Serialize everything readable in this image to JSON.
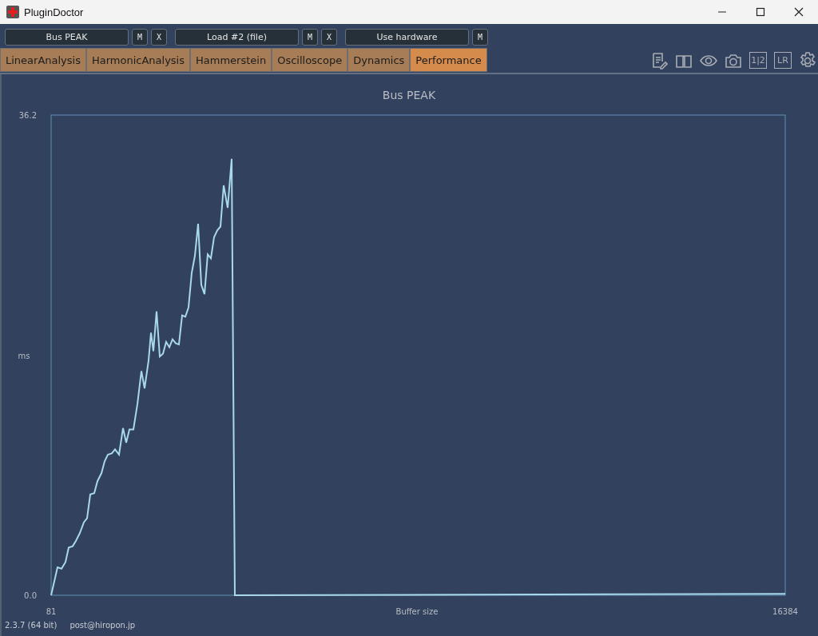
{
  "window": {
    "title": "PluginDoctor"
  },
  "slots": [
    {
      "label": "Bus PEAK",
      "buttons": [
        "M",
        "X"
      ]
    },
    {
      "label": "Load #2 (file)",
      "buttons": [
        "M",
        "X"
      ]
    },
    {
      "label": "Use hardware",
      "buttons": [
        "M"
      ]
    }
  ],
  "tabs": [
    {
      "label": "LinearAnalysis",
      "selected": false
    },
    {
      "label": "HarmonicAnalysis",
      "selected": false
    },
    {
      "label": "Hammerstein",
      "selected": false
    },
    {
      "label": "Oscilloscope",
      "selected": false
    },
    {
      "label": "Dynamics",
      "selected": false
    },
    {
      "label": "Performance",
      "selected": true
    }
  ],
  "tools": [
    {
      "kind": "notes"
    },
    {
      "kind": "book"
    },
    {
      "kind": "eye"
    },
    {
      "kind": "camera"
    },
    {
      "kind": "text",
      "label": "1|2"
    },
    {
      "kind": "text",
      "label": "LR"
    },
    {
      "kind": "gear"
    }
  ],
  "chart": {
    "chart_data": {
      "type": "line",
      "title": "Bus PEAK",
      "xlabel": "Buffer size",
      "ylabel": "ms",
      "xlim": [
        81,
        16384
      ],
      "ylim": [
        0,
        36.2
      ],
      "xticks": [
        81,
        16384
      ],
      "yticks": [
        {
          "value": 0,
          "label": "0.0"
        },
        36.2
      ],
      "x": [
        81,
        223,
        312,
        401,
        472,
        560,
        631,
        720,
        808,
        879,
        950,
        1039,
        1110,
        1199,
        1270,
        1341,
        1429,
        1500,
        1589,
        1678,
        1749,
        1820,
        1908,
        1997,
        2086,
        2157,
        2245,
        2299,
        2352,
        2423,
        2494,
        2565,
        2636,
        2707,
        2777,
        2848,
        2919,
        2990,
        3061,
        3132,
        3203,
        3274,
        3345,
        3416,
        3487,
        3558,
        3629,
        3700,
        3771,
        3842,
        3913,
        4002,
        4090,
        4161,
        16384
      ],
      "series": [
        {
          "color": "#a8d8ea",
          "values": [
            0,
            2.1,
            2.0,
            2.5,
            3.6,
            3.7,
            4.1,
            4.7,
            5.5,
            5.8,
            7.6,
            7.7,
            8.6,
            9.2,
            10.1,
            10.6,
            10.7,
            11.0,
            10.6,
            12.6,
            11.5,
            12.5,
            12.5,
            14.4,
            16.9,
            15.6,
            17.7,
            19.8,
            18.4,
            21.4,
            18.0,
            18.2,
            19.1,
            18.7,
            19.3,
            19.0,
            18.9,
            21.1,
            21.0,
            21.7,
            24.3,
            25.6,
            28.0,
            23.4,
            22.7,
            25.7,
            25.4,
            27.0,
            27.5,
            27.8,
            30.9,
            29.2,
            32.9,
            0,
            0.1
          ]
        }
      ]
    }
  },
  "footer": {
    "version": "2.3.7 (64 bit)",
    "email": "post@hiropon.jp"
  }
}
